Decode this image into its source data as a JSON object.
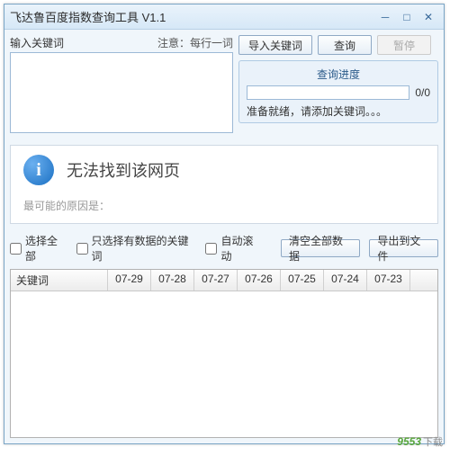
{
  "window": {
    "title": "飞达鲁百度指数查询工具 V1.1"
  },
  "input": {
    "label": "输入关键词",
    "hint": "注意：每行一词",
    "value": ""
  },
  "buttons": {
    "import": "导入关键词",
    "query": "查询",
    "pause": "暂停",
    "clear": "清空全部数据",
    "export": "导出到文件"
  },
  "progress": {
    "title": "查询进度",
    "count": "0/0",
    "status": "准备就绪，请添加关键词。。。"
  },
  "message": {
    "main": "无法找到该网页",
    "sub": "最可能的原因是："
  },
  "options": {
    "select_all": "选择全部",
    "only_data": "只选择有数据的关键词",
    "auto_scroll": "自动滚动"
  },
  "table": {
    "headers": [
      "关键词",
      "07-29",
      "07-28",
      "07-27",
      "07-26",
      "07-25",
      "07-24",
      "07-23"
    ]
  },
  "watermark": {
    "main": "9553",
    "sub": "下载"
  }
}
